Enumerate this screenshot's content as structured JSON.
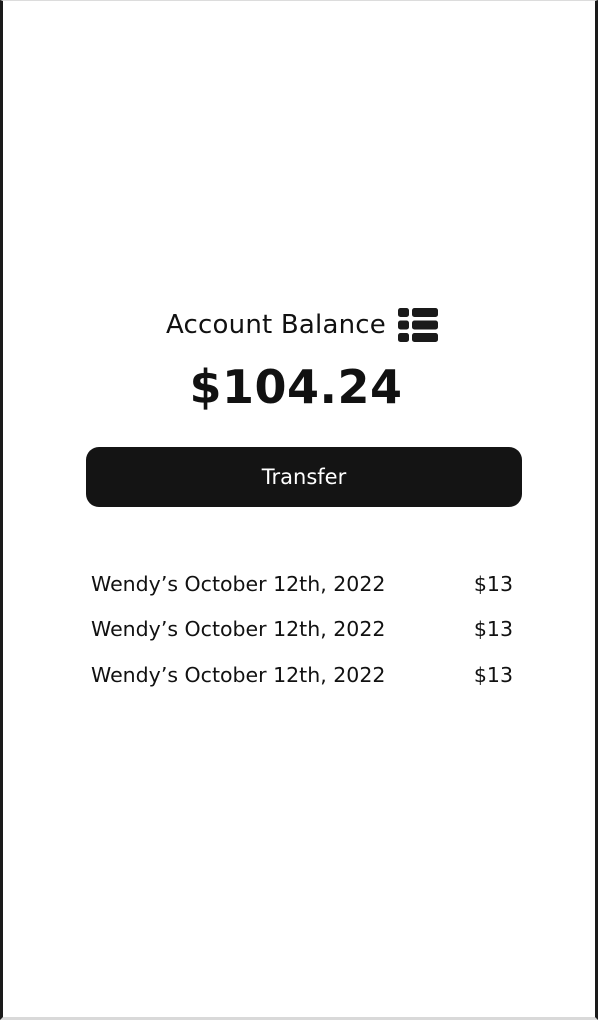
{
  "balance": {
    "title": "Account Balance",
    "icon": "list-icon",
    "amount": "$104.24"
  },
  "actions": {
    "transfer_label": "Transfer"
  },
  "transactions": [
    {
      "description": "Wendy’s October 12th, 2022",
      "amount": "$13"
    },
    {
      "description": "Wendy’s October 12th, 2022",
      "amount": "$13"
    },
    {
      "description": "Wendy’s October 12th, 2022",
      "amount": "$13"
    }
  ],
  "colors": {
    "text": "#111111",
    "button_bg": "#141414",
    "button_text": "#ffffff",
    "background": "#ffffff",
    "frame": "#1a1a1a"
  }
}
